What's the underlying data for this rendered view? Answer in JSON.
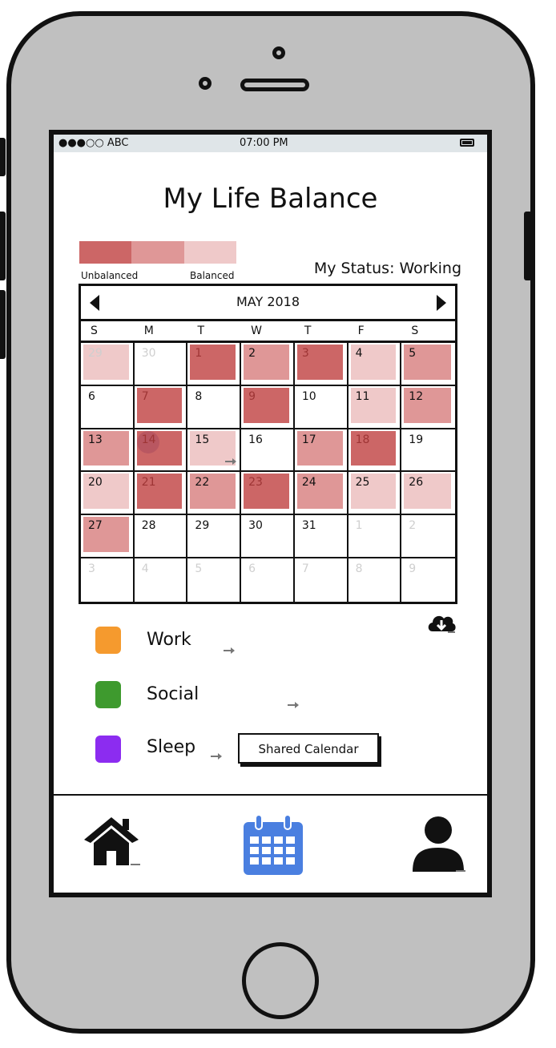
{
  "status_bar": {
    "carrier": "●●●○○ ABC",
    "time": "07:00 PM",
    "battery_icon": "battery-icon"
  },
  "app": {
    "title": "My Life Balance"
  },
  "legend": {
    "colors": [
      "#cc6666",
      "#df9797",
      "#efc9c9"
    ],
    "unbalanced_label": "Unbalanced",
    "balanced_label": "Balanced"
  },
  "status": {
    "text": "My Status: Working"
  },
  "calendar": {
    "month_label": "MAY 2018",
    "prev_icon": "arrow-left-icon",
    "next_icon": "arrow-right-icon",
    "weekdays": [
      "S",
      "M",
      "T",
      "W",
      "T",
      "F",
      "S"
    ],
    "days": [
      {
        "n": "29",
        "other": true,
        "level": 1
      },
      {
        "n": "30",
        "other": true,
        "level": 0
      },
      {
        "n": "1",
        "other": false,
        "level": 3
      },
      {
        "n": "2",
        "other": false,
        "level": 2
      },
      {
        "n": "3",
        "other": false,
        "level": 3
      },
      {
        "n": "4",
        "other": false,
        "level": 1
      },
      {
        "n": "5",
        "other": false,
        "level": 2
      },
      {
        "n": "6",
        "other": false,
        "level": 0
      },
      {
        "n": "7",
        "other": false,
        "level": 3
      },
      {
        "n": "8",
        "other": false,
        "level": 0
      },
      {
        "n": "9",
        "other": false,
        "level": 3
      },
      {
        "n": "10",
        "other": false,
        "level": 0
      },
      {
        "n": "11",
        "other": false,
        "level": 1
      },
      {
        "n": "12",
        "other": false,
        "level": 2
      },
      {
        "n": "13",
        "other": false,
        "level": 2
      },
      {
        "n": "14",
        "other": false,
        "level": 3,
        "today": true
      },
      {
        "n": "15",
        "other": false,
        "level": 1,
        "link": true
      },
      {
        "n": "16",
        "other": false,
        "level": 0
      },
      {
        "n": "17",
        "other": false,
        "level": 2
      },
      {
        "n": "18",
        "other": false,
        "level": 3
      },
      {
        "n": "19",
        "other": false,
        "level": 0
      },
      {
        "n": "20",
        "other": false,
        "level": 1
      },
      {
        "n": "21",
        "other": false,
        "level": 3
      },
      {
        "n": "22",
        "other": false,
        "level": 2
      },
      {
        "n": "23",
        "other": false,
        "level": 3
      },
      {
        "n": "24",
        "other": false,
        "level": 2
      },
      {
        "n": "25",
        "other": false,
        "level": 1
      },
      {
        "n": "26",
        "other": false,
        "level": 1
      },
      {
        "n": "27",
        "other": false,
        "level": 2
      },
      {
        "n": "28",
        "other": false,
        "level": 0
      },
      {
        "n": "29",
        "other": false,
        "level": 0
      },
      {
        "n": "30",
        "other": false,
        "level": 0
      },
      {
        "n": "31",
        "other": false,
        "level": 0
      },
      {
        "n": "1",
        "other": true,
        "level": 0
      },
      {
        "n": "2",
        "other": true,
        "level": 0
      },
      {
        "n": "3",
        "other": true,
        "level": 0
      },
      {
        "n": "4",
        "other": true,
        "level": 0
      },
      {
        "n": "5",
        "other": true,
        "level": 0
      },
      {
        "n": "6",
        "other": true,
        "level": 0
      },
      {
        "n": "7",
        "other": true,
        "level": 0
      },
      {
        "n": "8",
        "other": true,
        "level": 0
      },
      {
        "n": "9",
        "other": true,
        "level": 0
      }
    ]
  },
  "categories": [
    {
      "label": "Work",
      "color": "#f59a2e"
    },
    {
      "label": "Social",
      "color": "#3e9a2e"
    },
    {
      "label": "Sleep",
      "color": "#8c2cf0"
    }
  ],
  "download_icon": "cloud-download-icon",
  "shared_calendar": {
    "label": "Shared Calendar"
  },
  "tab_bar": {
    "home_icon": "home-icon",
    "calendar_icon": "calendar-icon",
    "calendar_color": "#4a7fe0",
    "profile_icon": "user-icon"
  }
}
